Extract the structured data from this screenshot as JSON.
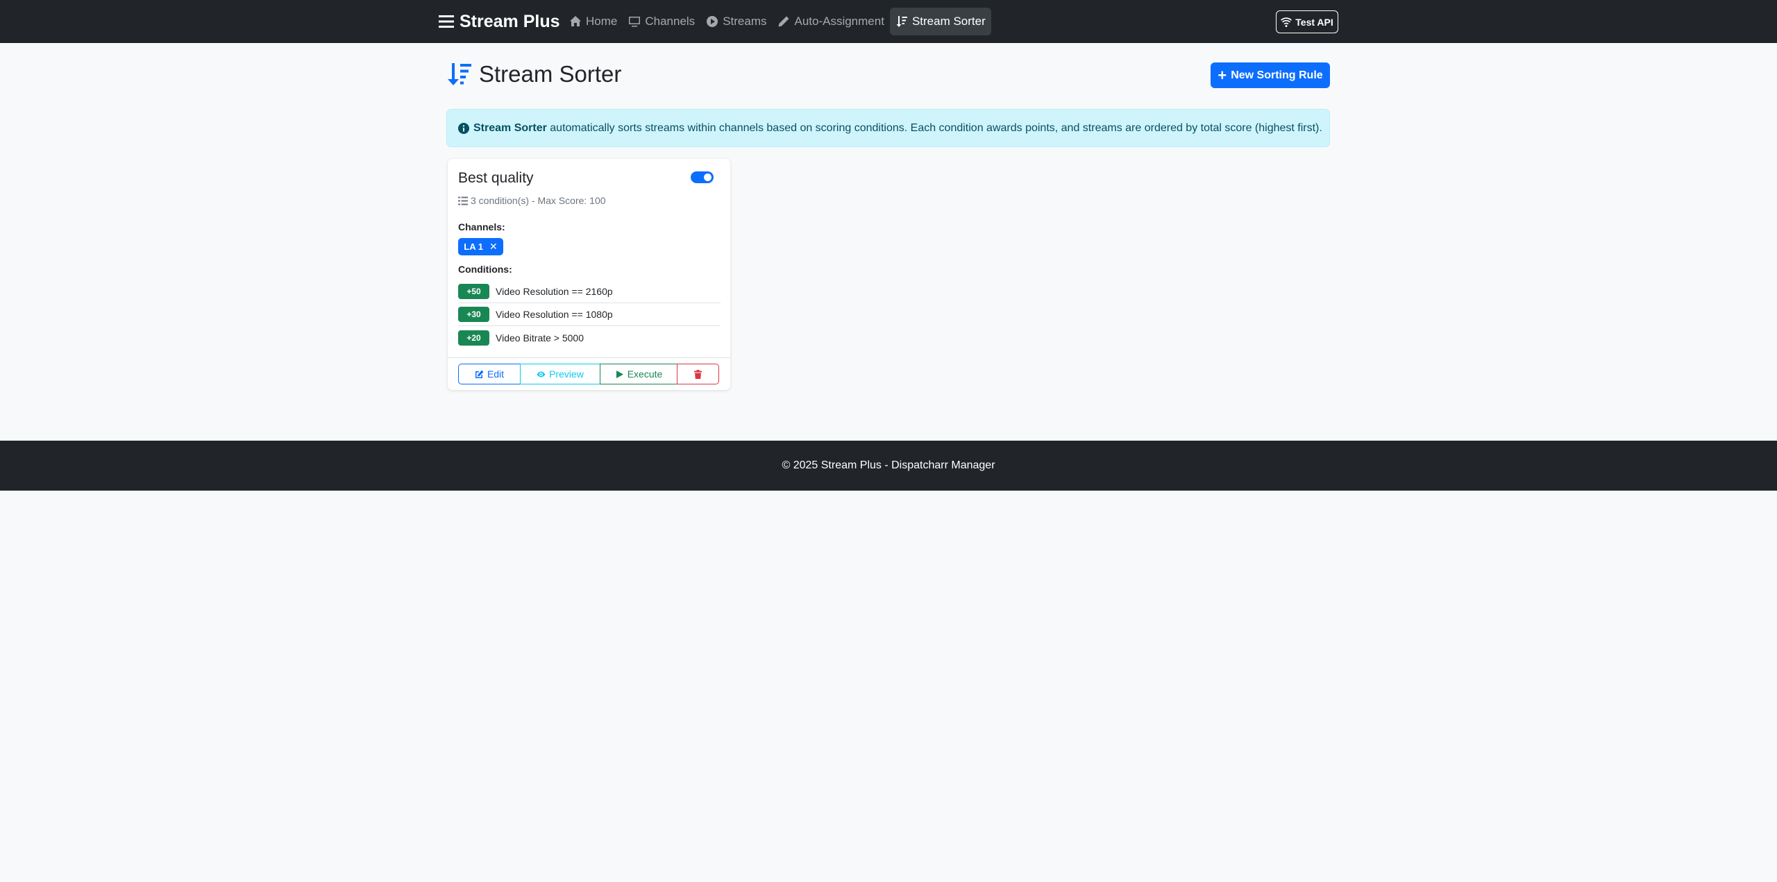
{
  "navbar": {
    "brand": "Stream Plus",
    "links": [
      {
        "label": "Home",
        "icon": "home-icon"
      },
      {
        "label": "Channels",
        "icon": "monitor-icon"
      },
      {
        "label": "Streams",
        "icon": "play-circle-icon"
      },
      {
        "label": "Auto-Assignment",
        "icon": "pencil-icon"
      },
      {
        "label": "Stream Sorter",
        "icon": "sort-icon",
        "active": true
      }
    ],
    "test_api": "Test API"
  },
  "header": {
    "title": "Stream Sorter",
    "new_rule_button": "New Sorting Rule"
  },
  "alert": {
    "strong": "Stream Sorter",
    "text": " automatically sorts streams within channels based on scoring conditions. Each condition awards points, and streams are ordered by total score (highest first)."
  },
  "rule_card": {
    "title": "Best quality",
    "enabled": true,
    "meta": "3 condition(s) - Max Score: 100",
    "channels_label": "Channels:",
    "channels": [
      "LA 1"
    ],
    "conditions_label": "Conditions:",
    "conditions": [
      {
        "score": "+50",
        "text": "Video Resolution == 2160p"
      },
      {
        "score": "+30",
        "text": "Video Resolution == 1080p"
      },
      {
        "score": "+20",
        "text": "Video Bitrate > 5000"
      }
    ],
    "actions": {
      "edit": "Edit",
      "preview": "Preview",
      "execute": "Execute"
    }
  },
  "footer": {
    "text": "© 2025 Stream Plus - Dispatcharr Manager"
  },
  "colors": {
    "navbar_bg": "#212529",
    "primary": "#0d6efd",
    "success": "#198754",
    "info": "#0dcaf0",
    "danger": "#dc3545",
    "alert_bg": "#cff4fc"
  }
}
